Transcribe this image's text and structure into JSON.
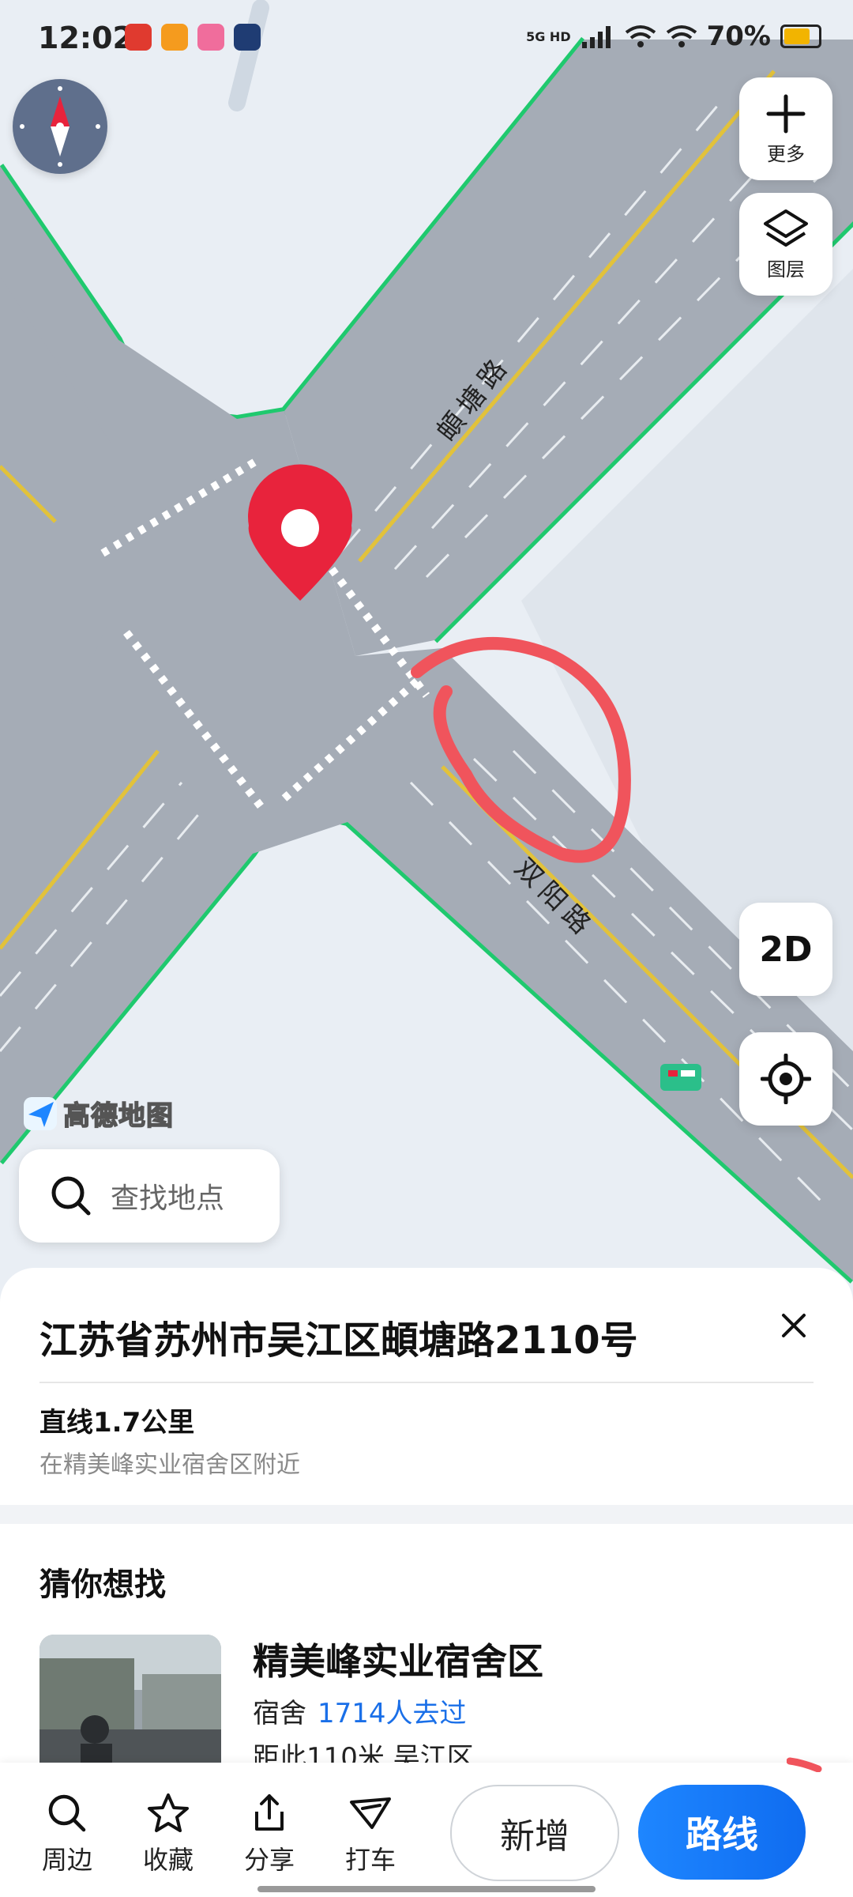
{
  "status_bar": {
    "time": "12:02",
    "network": "5G HD",
    "battery": "70%"
  },
  "map": {
    "road_north": "頔塘路",
    "road_east": "双阳路",
    "logo": "高德地图",
    "btn_more": "更多",
    "btn_layers": "图层",
    "btn_2d": "2D",
    "search_placeholder": "查找地点",
    "colors": {
      "road": "#a5acb6",
      "road_edge": "#1fc96e",
      "center_line": "#e2c23a",
      "pin": "#e8233c",
      "annotation": "#f0545c"
    }
  },
  "location_card": {
    "address": "江苏省苏州市吴江区頔塘路2110号",
    "distance": "直线1.7公里",
    "nearby": "在精美峰实业宿舍区附近"
  },
  "suggestions": {
    "title": "猜你想找",
    "items": [
      {
        "name": "精美峰实业宿舍区",
        "category": "宿舍",
        "visits": "1714人去过",
        "distance": "距此110米  吴江区"
      }
    ]
  },
  "bottom_bar": {
    "actions": [
      "周边",
      "收藏",
      "分享",
      "打车"
    ],
    "btn_add": "新增",
    "btn_route": "路线"
  }
}
